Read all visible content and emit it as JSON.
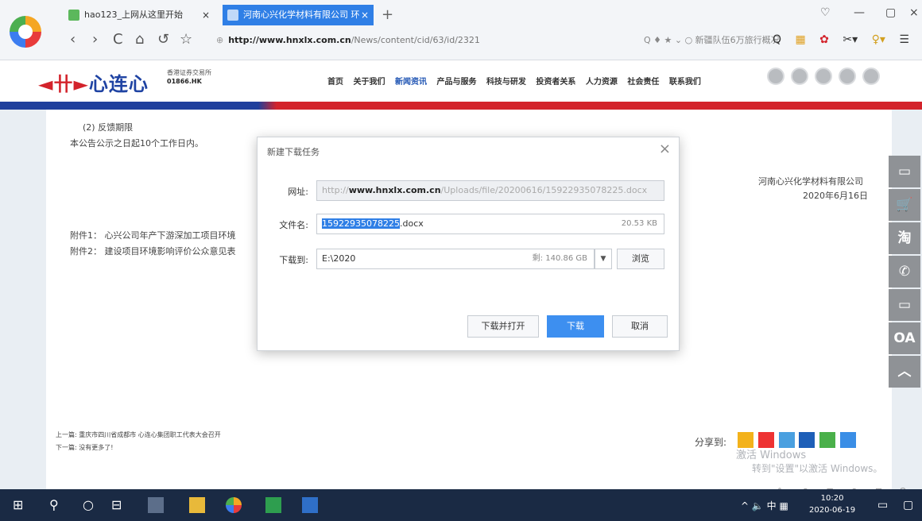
{
  "browser": {
    "tabs": [
      {
        "title": "hao123_上网从这里开始",
        "close": "×"
      },
      {
        "title": "河南心兴化学材料有限公司 环",
        "close": "×"
      }
    ],
    "new_tab": "+",
    "nav": {
      "back": "‹",
      "forward": "›",
      "refresh": "C",
      "home": "⌂",
      "undo": "↺",
      "star": "☆"
    },
    "address_host": "http://www.hnxlx.com.cn",
    "address_path": "/News/content/cid/63/id/2321",
    "address_right": "Q  ♦  ★  ⌄  ○ 新疆队伍6万旅行概况",
    "toolbar_icons": [
      "Q",
      "▦",
      "✿",
      "✂▾",
      "♀▾",
      "☰"
    ],
    "window": {
      "minimize": "—",
      "restore": "▢",
      "close": "×",
      "shield": "♡"
    }
  },
  "site": {
    "brand_name": "心连心",
    "brand_sub_line1": "香港证券交易所",
    "brand_sub_code": "01866.HK",
    "nav": [
      "首页",
      "关于我们",
      "新闻资讯",
      "产品与服务",
      "科技与研发",
      "投资者关系",
      "人力资源",
      "社会责任",
      "联系我们"
    ],
    "nav_active_index": 2
  },
  "content": {
    "heading": "(2) 反馈期限",
    "para": "本公告公示之日起10个工作日内。",
    "company": "河南心兴化学材料有限公司",
    "date": "2020年6月16日",
    "attach1": "附件1：  心兴公司年产下游深加工项目环境",
    "attach2": "附件2：  建设项目环境影响评价公众意见表",
    "prev": "上一篇: 重庆市四川省成都市 心连心集团职工代表大会召开",
    "next": "下一篇: 没有更多了!",
    "share_label": "分享到:",
    "watermark1": "激活 Windows",
    "watermark2": "转到\"设置\"以激活 Windows。",
    "bottom_tools": [
      "✎",
      "⊕",
      "⊟",
      "⊕",
      "⊞",
      "Q"
    ]
  },
  "floatbar": [
    "▭",
    "🛒",
    "淘",
    "✆",
    "▭",
    "OA",
    "︿"
  ],
  "dialog": {
    "title": "新建下载任务",
    "close": "×",
    "url_label": "网址:",
    "url_prefix": "http://",
    "url_host": "www.hnxlx.com.cn",
    "url_rest": "/Uploads/file/20200616/15922935078225.docx",
    "filename_label": "文件名:",
    "filename_selected": "15922935078225",
    "filename_ext": ".docx",
    "filesize": "20.53 KB",
    "saveto_label": "下载到:",
    "saveto_path": "E:\\2020",
    "disk_free": "剩: 140.86 GB",
    "dropdown": "▼",
    "browse": "浏览",
    "btn_open": "下载并打开",
    "btn_download": "下载",
    "btn_cancel": "取消"
  },
  "taskbar": {
    "start": "⊞",
    "search": "⚲",
    "cortana": "○",
    "taskview": "⊟",
    "tray": "^ 🔈 中 ▦",
    "time": "10:20",
    "date": "2020-06-19",
    "notify": "▭"
  },
  "colors": {
    "brand_blue": "#1f43a3",
    "brand_red": "#d3232b",
    "tab_active": "#2f7fe6",
    "primary_button": "#3d8ff0",
    "taskbar": "#1a2a44"
  }
}
